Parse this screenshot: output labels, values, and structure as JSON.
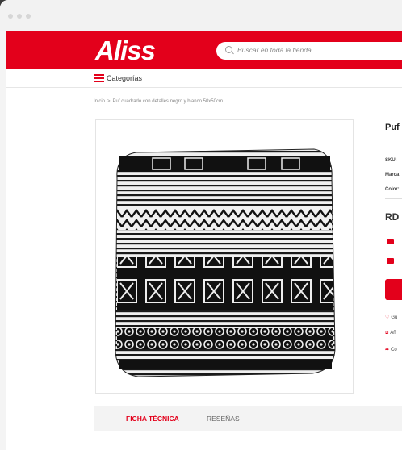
{
  "header": {
    "logo_text": "Aliss",
    "search_placeholder": "Buscar en toda la tienda..."
  },
  "nav": {
    "categories_label": "Categorías"
  },
  "breadcrumb": {
    "items": [
      "Inicio",
      "Puf cuadrado con detalles negro y blanco 50x50cm"
    ]
  },
  "product": {
    "title_partial": "Puf bla",
    "meta": [
      "SKU:",
      "Marca",
      "Color:"
    ],
    "price_partial": "RD",
    "links": [
      "Gu",
      "Añ",
      "Co"
    ]
  },
  "tabs": [
    {
      "label": "FICHA TÉCNICA",
      "active": true
    },
    {
      "label": "RESEÑAS",
      "active": false
    }
  ],
  "colors": {
    "brand_red": "#e3001b"
  }
}
